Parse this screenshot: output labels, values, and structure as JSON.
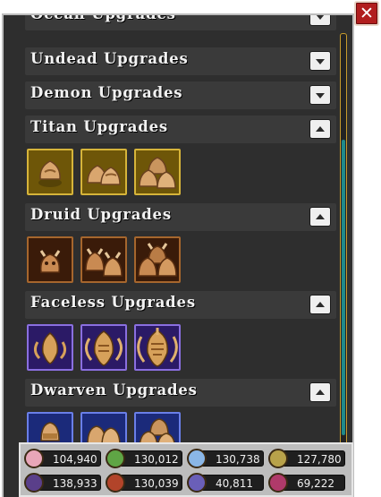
{
  "window": {
    "close_symbol": "✕"
  },
  "sections": [
    {
      "id": "ocean",
      "title": "Ocean Upgrades",
      "expanded": false,
      "toggle_icon": "chevron-down-icon"
    },
    {
      "id": "undead",
      "title": "Undead Upgrades",
      "expanded": false,
      "toggle_icon": "chevron-down-icon"
    },
    {
      "id": "demon",
      "title": "Demon Upgrades",
      "expanded": false,
      "toggle_icon": "chevron-down-icon"
    },
    {
      "id": "titan",
      "title": "Titan Upgrades",
      "expanded": true,
      "toggle_icon": "chevron-up-icon",
      "upgrades": [
        "titan-one-icon",
        "titan-two-icon",
        "titan-three-icon"
      ],
      "accent": "#d6b43a"
    },
    {
      "id": "druid",
      "title": "Druid Upgrades",
      "expanded": true,
      "toggle_icon": "chevron-up-icon",
      "upgrades": [
        "druid-one-icon",
        "druid-two-icon",
        "druid-three-icon"
      ],
      "accent": "#a6662d"
    },
    {
      "id": "faceless",
      "title": "Faceless Upgrades",
      "expanded": true,
      "toggle_icon": "chevron-up-icon",
      "upgrades": [
        "faceless-one-icon",
        "faceless-two-icon",
        "faceless-three-icon"
      ],
      "accent": "#8a6fe0"
    },
    {
      "id": "dwarven",
      "title": "Dwarven Upgrades",
      "expanded": true,
      "toggle_icon": "chevron-up-icon",
      "upgrades": [
        "dwarven-one-icon",
        "dwarven-two-icon",
        "dwarven-three-icon"
      ],
      "accent": "#6a7fe8"
    }
  ],
  "resources": [
    {
      "icon": "angel-resource-icon",
      "value": "104,940",
      "color": "#e8a6b8"
    },
    {
      "icon": "goblin-resource-icon",
      "value": "130,012",
      "color": "#5fa545"
    },
    {
      "icon": "skull-resource-icon",
      "value": "130,738",
      "color": "#8ab6e6"
    },
    {
      "icon": "coin-resource-icon",
      "value": "127,780",
      "color": "#b8a24a"
    },
    {
      "icon": "wizard-resource-icon",
      "value": "138,933",
      "color": "#5a3f8a"
    },
    {
      "icon": "demon-resource-icon",
      "value": "130,039",
      "color": "#b2442a"
    },
    {
      "icon": "titan-resource-icon",
      "value": "40,811",
      "color": "#6a5fb8"
    },
    {
      "icon": "faceless-resource-icon",
      "value": "69,222",
      "color": "#b03a6a"
    }
  ],
  "colors": {
    "panel_bg": "#2e2e2e",
    "header_bg": "#3a3a3a",
    "scroll_thumb": "#1f8a8a",
    "close_red": "#b11e1e"
  }
}
